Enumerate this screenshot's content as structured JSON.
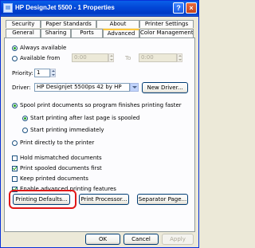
{
  "window": {
    "title": "HP DesignJet 5500 - 1 Properties",
    "help_label": "?",
    "close_label": "×"
  },
  "tabs": {
    "row_back": [
      "Security",
      "Paper Standards",
      "About",
      "Printer Settings"
    ],
    "row_front": [
      "General",
      "Sharing",
      "Ports",
      "Advanced",
      "Color Management"
    ],
    "active": "Advanced"
  },
  "availability": {
    "always_label": "Always available",
    "always_selected": true,
    "from_label": "Available from",
    "from_value": "0:00",
    "to_label": "To",
    "to_value": "0:00"
  },
  "priority": {
    "label": "Priority:",
    "value": "1"
  },
  "driver": {
    "label": "Driver:",
    "value": "HP Designjet 5500ps 42 by HP",
    "new_driver_label": "New Driver..."
  },
  "spool": {
    "spool_label": "Spool print documents so program finishes printing faster",
    "start_after_last_label": "Start printing after last page is spooled",
    "start_immediately_label": "Start printing immediately",
    "direct_label": "Print directly to the printer"
  },
  "options": [
    {
      "label": "Hold mismatched documents",
      "checked": false
    },
    {
      "label": "Print spooled documents first",
      "checked": true
    },
    {
      "label": "Keep printed documents",
      "checked": false
    },
    {
      "label": "Enable advanced printing features",
      "checked": true
    }
  ],
  "buttons": {
    "printing_defaults": "Printing Defaults...",
    "print_processor": "Print Processor...",
    "separator_page": "Separator Page..."
  },
  "footer": {
    "ok": "OK",
    "cancel": "Cancel",
    "apply": "Apply"
  },
  "colors": {
    "title_bar": "#0a5fe8",
    "highlight_ring": "#e01818",
    "face": "#ece9d8"
  }
}
